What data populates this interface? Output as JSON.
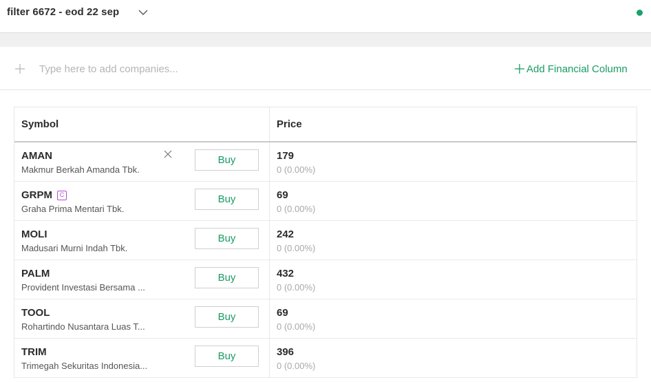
{
  "header": {
    "title": "filter 6672 - eod 22 sep",
    "status_color": "#1aa26b"
  },
  "add_row": {
    "placeholder": "Type here to add companies...",
    "add_financial_label": "Add Financial Column"
  },
  "table": {
    "columns": [
      "Symbol",
      "Price"
    ],
    "buy_label": "Buy",
    "rows": [
      {
        "symbol": "AMAN",
        "company": "Makmur Berkah Amanda Tbk.",
        "price": "179",
        "change": "0 (0.00%)",
        "badge": "",
        "removable": true
      },
      {
        "symbol": "GRPM",
        "company": "Graha Prima Mentari Tbk.",
        "price": "69",
        "change": "0 (0.00%)",
        "badge": "C",
        "removable": false
      },
      {
        "symbol": "MOLI",
        "company": "Madusari Murni Indah Tbk.",
        "price": "242",
        "change": "0 (0.00%)",
        "badge": "",
        "removable": false
      },
      {
        "symbol": "PALM",
        "company": "Provident Investasi Bersama ...",
        "price": "432",
        "change": "0 (0.00%)",
        "badge": "",
        "removable": false
      },
      {
        "symbol": "TOOL",
        "company": "Rohartindo Nusantara Luas T...",
        "price": "69",
        "change": "0 (0.00%)",
        "badge": "",
        "removable": false
      },
      {
        "symbol": "TRIM",
        "company": "Trimegah Sekuritas Indonesia...",
        "price": "396",
        "change": "0 (0.00%)",
        "badge": "",
        "removable": false
      }
    ]
  },
  "icons": {
    "dropdown": "chevron-down-icon",
    "add": "plus-icon",
    "remove": "close-icon",
    "status": "status-dot"
  },
  "colors": {
    "accent": "#1a9b63",
    "badge": "#b54ad6"
  }
}
